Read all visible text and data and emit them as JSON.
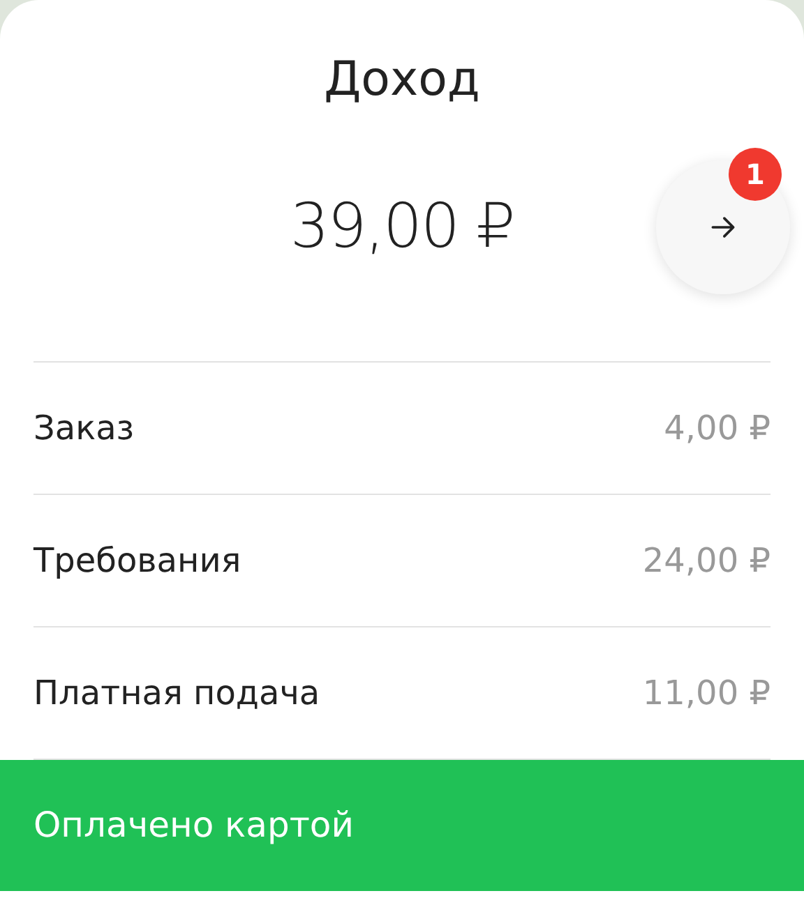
{
  "title": "Доход",
  "total": "39,00 ₽",
  "next_button": {
    "badge": "1"
  },
  "rows": [
    {
      "label": "Заказ",
      "amount": "4,00 ₽"
    },
    {
      "label": "Требования",
      "amount": "24,00 ₽"
    },
    {
      "label": "Платная подача",
      "amount": "11,00 ₽"
    }
  ],
  "payment_banner": "Оплачено картой"
}
